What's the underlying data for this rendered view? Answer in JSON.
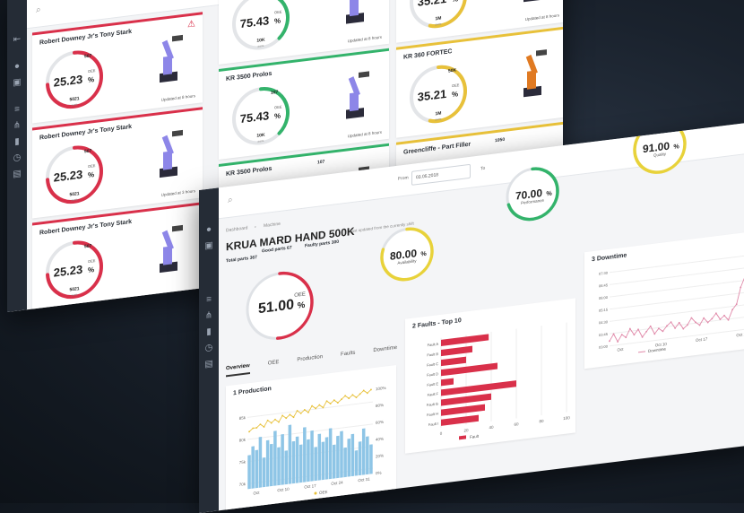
{
  "fleet": {
    "cards": [
      {
        "name": "Robert Downey Jr's Tony Stark",
        "oee": "25.23",
        "good": "5021",
        "bad": "507",
        "updated": "Updated at 8 hours",
        "accent": "#d9304a",
        "warning": true,
        "robot": "purple"
      },
      {
        "name": "KR 3500 Prolos",
        "oee": "75.43",
        "good": "10K",
        "bad": "107",
        "updated": "Updated at 8 hours",
        "accent": "#33b36b",
        "warning": false,
        "robot": "purple"
      },
      {
        "name": "KR 360 FORTEC",
        "oee": "35.21",
        "good": "1M",
        "bad": "50K",
        "updated": "Updated at 8 hours",
        "accent": "#e8c13a",
        "warning": false,
        "robot": "orange"
      },
      {
        "name": "Robert Downey Jr's Tony Stark",
        "oee": "25.23",
        "good": "5021",
        "bad": "507",
        "updated": "Updated at 3 hours",
        "accent": "#d9304a",
        "warning": false,
        "robot": "purple"
      },
      {
        "name": "KR 3500 Prolos",
        "oee": "75.43",
        "good": "10K",
        "bad": "107",
        "updated": "Updated at 8 hours",
        "accent": "#33b36b",
        "warning": false,
        "robot": "purple"
      },
      {
        "name": "KR 360 FORTEC",
        "oee": "35.21",
        "good": "1M",
        "bad": "50K",
        "updated": "",
        "accent": "#e8c13a",
        "warning": false,
        "robot": "orange"
      },
      {
        "name": "Robert Downey Jr's Tony Stark",
        "oee": "25.23",
        "good": "5021",
        "bad": "507",
        "updated": "",
        "accent": "#d9304a",
        "warning": false,
        "robot": "purple"
      },
      {
        "name": "KR 3500 Prolos",
        "oee": "",
        "good": "",
        "bad": "107",
        "updated": "",
        "accent": "#33b36b",
        "warning": false,
        "robot": "purple"
      },
      {
        "name": "Greencliffe - Part Filler",
        "oee": "",
        "good": "",
        "bad": "1050",
        "updated": "",
        "accent": "#e8c13a",
        "warning": false,
        "robot": ""
      }
    ],
    "oee_label": "OEE",
    "good_label": "parts",
    "bad_label": "faulty",
    "top_fragments": {
      "left": "",
      "mid": "1M"
    }
  },
  "machine": {
    "breadcrumb": [
      "Dashboard",
      "Machine"
    ],
    "title": "KRUA MARD HAND 500K",
    "title_note": "Last updated from the currently shift",
    "good_parts": "Good parts 67",
    "faulty_parts": "Faulty parts 300",
    "total_parts": "Total parts 367",
    "from_label": "From",
    "from_value": "03.05.2018",
    "to_label": "To",
    "gauges": [
      {
        "value": "51.00",
        "unit": "%",
        "label": "OEE",
        "color": "#d9304a",
        "fraction": 0.51
      },
      {
        "value": "80.00",
        "unit": "%",
        "label": "Availability",
        "color": "#e8d23a",
        "fraction": 0.8
      },
      {
        "value": "70.00",
        "unit": "%",
        "label": "Performance",
        "color": "#33b36b",
        "fraction": 0.7
      },
      {
        "value": "91.00",
        "unit": "%",
        "label": "Quality",
        "color": "#e8d23a",
        "fraction": 0.91
      }
    ],
    "tabs": [
      "Overview",
      "OEE",
      "Production",
      "Faults",
      "Downtime",
      "Station view",
      "Documentation"
    ],
    "production": {
      "title": "1 Production",
      "legend": "OEE"
    },
    "faults": {
      "title": "2 Faults - Top 10",
      "legend": "Fault"
    },
    "downtime": {
      "title": "3 Downtime",
      "legend": "Downtime"
    }
  },
  "chart_data": [
    {
      "type": "bar",
      "title": "2 Faults - Top 10",
      "categories": [
        "Fault A",
        "Fault B",
        "Fault C",
        "Fault D",
        "Fault E",
        "Fault F",
        "Fault G",
        "Fault H",
        "Fault I"
      ],
      "values": [
        38,
        25,
        20,
        45,
        10,
        60,
        40,
        35,
        30
      ],
      "xticks": [
        "0",
        "20",
        "40",
        "60",
        "80",
        "100"
      ],
      "xlim": [
        0,
        100
      ],
      "color": "#d9304a"
    },
    {
      "type": "line",
      "title": "3 Downtime",
      "xticks": [
        "Oct",
        "Oct 10",
        "Oct 17",
        "Oct 24"
      ],
      "yticks": [
        "07:30",
        "06:45",
        "06:00",
        "05:15",
        "04:30",
        "03:45",
        "03:00"
      ],
      "values": [
        3.3,
        3.7,
        3.2,
        3.6,
        3.4,
        3.9,
        3.5,
        3.8,
        3.3,
        3.6,
        3.9,
        3.4,
        3.7,
        3.5,
        3.8,
        4.0,
        3.6,
        3.9,
        3.5,
        3.7,
        4.1,
        3.8,
        3.6,
        4.0,
        3.7,
        3.9,
        4.2,
        3.8,
        4.0,
        3.7,
        4.3,
        4.6,
        5.6,
        6.2,
        6.8,
        6.6
      ],
      "ylim": [
        3,
        7.5
      ],
      "color": "#e088a8"
    },
    {
      "type": "bar",
      "title": "1 Production",
      "xticks": [
        "Oct",
        "Oct 10",
        "Oct 17",
        "Oct 24",
        "Oct 31"
      ],
      "yticks_left": [
        "85k",
        "80k",
        "75k",
        "70k"
      ],
      "yticks_right": [
        "100%",
        "80%",
        "60%",
        "40%",
        "20%",
        "0%"
      ],
      "values": [
        78,
        80,
        79,
        82,
        77,
        81,
        80,
        83,
        79,
        82,
        78,
        84,
        80,
        81,
        79,
        83,
        80,
        82,
        78,
        81,
        79,
        80,
        82,
        78,
        80,
        81,
        77,
        79,
        80,
        76,
        78,
        81,
        79,
        77
      ],
      "line": [
        85,
        86,
        86,
        87,
        86,
        88,
        87,
        88,
        87,
        89,
        88,
        89,
        88,
        90,
        89,
        90,
        89,
        91,
        90,
        91,
        90,
        92,
        91,
        92,
        91,
        92,
        93,
        92,
        93,
        92,
        93,
        94,
        93,
        94
      ],
      "ylim": [
        70,
        90
      ],
      "bar_color": "#8ec5e6",
      "line_color": "#e8c13a"
    }
  ]
}
